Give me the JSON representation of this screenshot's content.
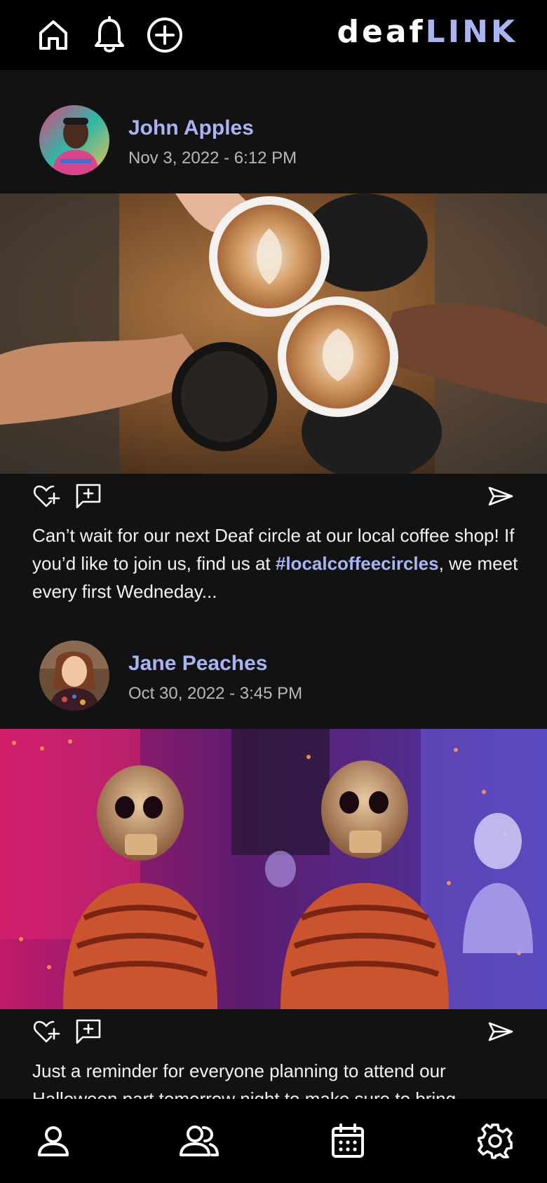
{
  "app": {
    "brand_part1": "deaf",
    "brand_part2": "LINK",
    "accent_color": "#a9b4f2",
    "background_color": "#121212"
  },
  "top_nav": {
    "items": [
      {
        "icon": "home-icon"
      },
      {
        "icon": "bell-icon"
      },
      {
        "icon": "plus-circle-icon"
      }
    ]
  },
  "posts": [
    {
      "author": "John Apples",
      "timestamp": "Nov 3, 2022 - 6:12 PM",
      "image_subject": "coffee-cheers-photo",
      "caption_before": "Can’t wait for our next Deaf circle at our local coffee shop! If you’d like to join us, find us at ",
      "hashtag": "#localcoffeecircles",
      "caption_after": ", we meet every first Wedneday..."
    },
    {
      "author": "Jane Peaches",
      "timestamp": "Oct 30, 2022 - 3:45 PM",
      "image_subject": "halloween-skeletons-photo",
      "caption_before": "Just a reminder for everyone planning to attend our Halloween part tomorrow night to make sure to bring",
      "hashtag": "",
      "caption_after": ""
    }
  ],
  "post_actions": {
    "icons": [
      "heart-plus-icon",
      "comment-plus-icon",
      "send-icon"
    ]
  },
  "bottom_nav": {
    "items": [
      {
        "icon": "profile-icon"
      },
      {
        "icon": "friends-icon"
      },
      {
        "icon": "calendar-icon"
      },
      {
        "icon": "settings-gear-icon"
      }
    ]
  }
}
